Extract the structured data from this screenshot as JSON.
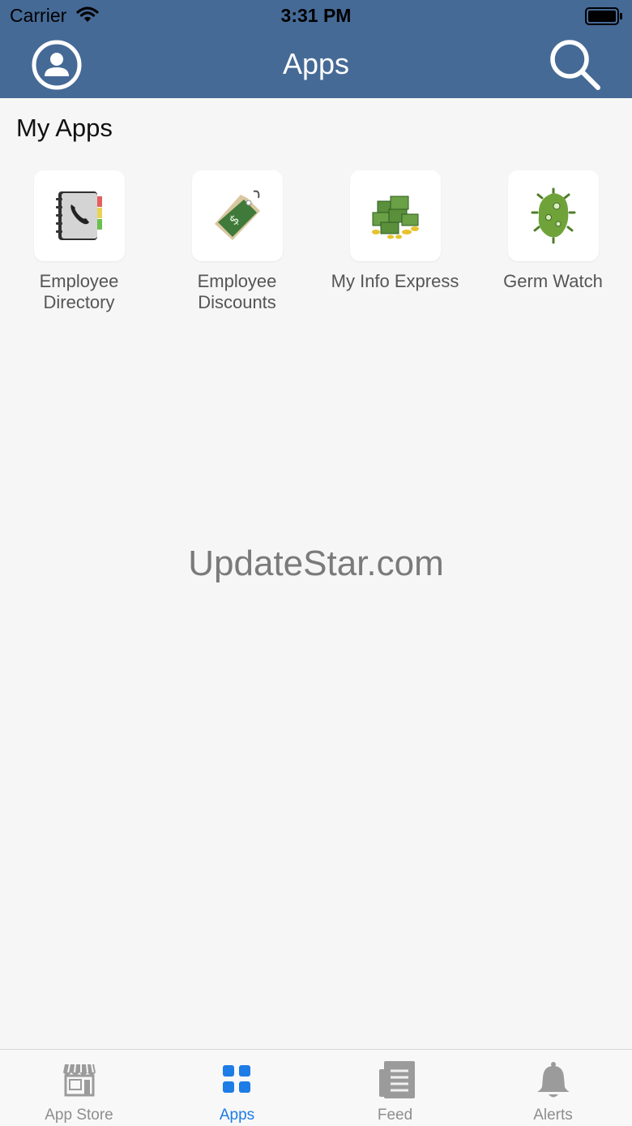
{
  "status_bar": {
    "carrier": "Carrier",
    "time": "3:31 PM"
  },
  "nav": {
    "title": "Apps",
    "profile_icon": "person-circle-icon",
    "search_icon": "search-icon"
  },
  "section": {
    "title": "My Apps"
  },
  "apps": [
    {
      "label": "Employee Directory",
      "icon": "address-book-icon"
    },
    {
      "label": "Employee Discounts",
      "icon": "price-tag-icon"
    },
    {
      "label": "My Info Express",
      "icon": "money-stack-icon"
    },
    {
      "label": "Germ Watch",
      "icon": "germ-icon"
    }
  ],
  "watermark": "UpdateStar.com",
  "tabs": [
    {
      "label": "App Store",
      "icon": "storefront-icon",
      "active": false
    },
    {
      "label": "Apps",
      "icon": "grid-icon",
      "active": true
    },
    {
      "label": "Feed",
      "icon": "newspaper-icon",
      "active": false
    },
    {
      "label": "Alerts",
      "icon": "bell-icon",
      "active": false
    }
  ],
  "colors": {
    "header": "#466a96",
    "background": "#f6f6f6",
    "active_tab": "#1d7ce6",
    "inactive_tab": "#8e8e8e"
  }
}
